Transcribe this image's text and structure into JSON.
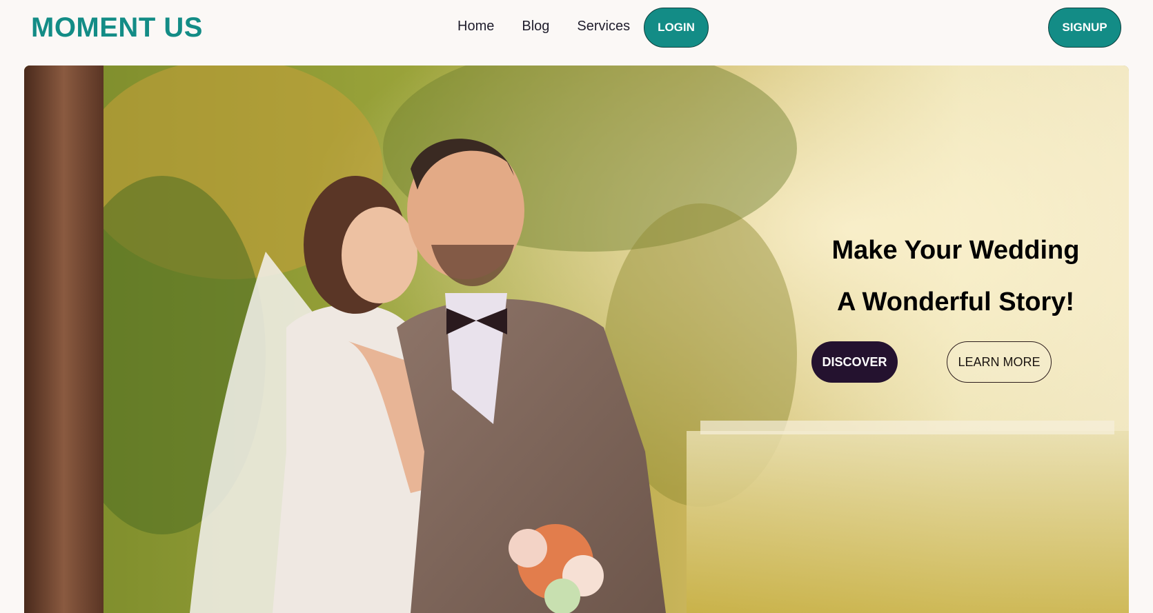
{
  "header": {
    "logo": "MOMENT US",
    "nav": [
      "Home",
      "Blog",
      "Services"
    ],
    "login_label": "LOGIN",
    "signup_label": "SIGNUP"
  },
  "hero": {
    "headline_line1": "Make Your Wedding",
    "headline_line2": "A Wonderful Story!",
    "discover_label": "DISCOVER",
    "learn_more_label": "LEARN MORE",
    "image": "photo of bride and groom in forest"
  },
  "colors": {
    "brand": "#138c86",
    "dark": "#24122f",
    "background": "#fbf8f6"
  }
}
